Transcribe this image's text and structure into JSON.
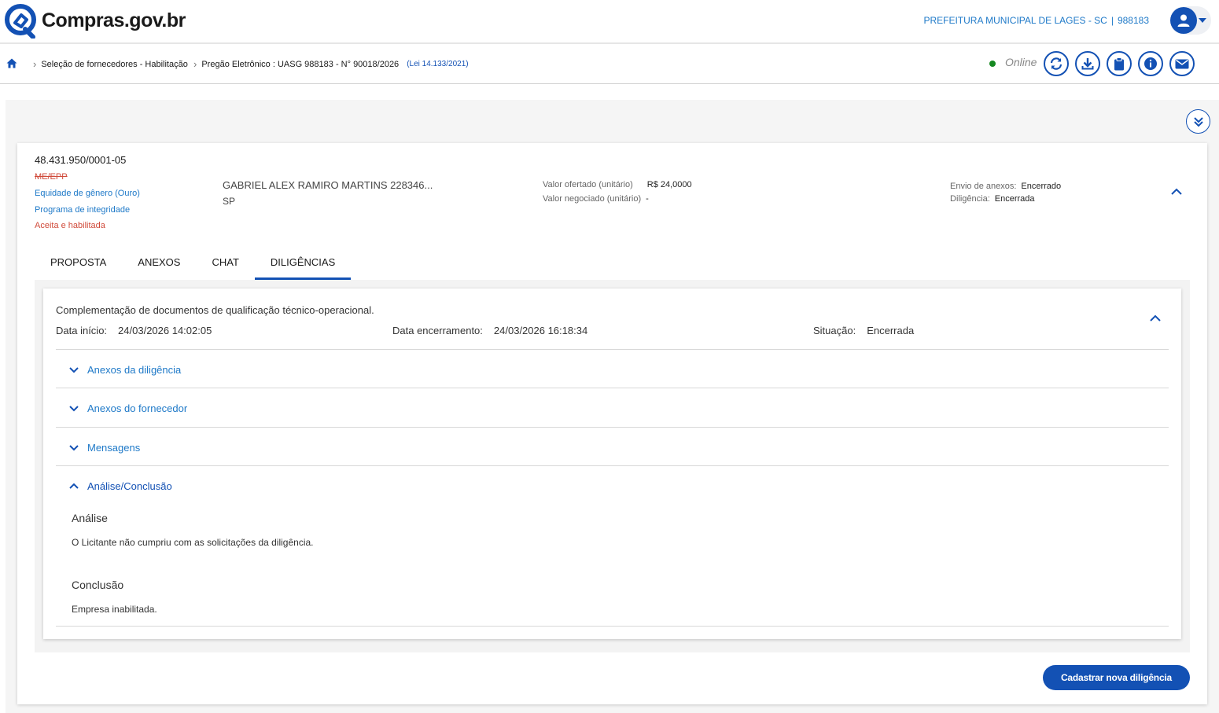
{
  "header": {
    "logo_text": "Compras.gov.br",
    "org_name": "PREFEITURA MUNICIPAL DE LAGES - SC",
    "org_sep": "|",
    "org_code": "988183"
  },
  "breadcrumb": {
    "items": [
      "Seleção de fornecedores - Habilitação",
      "Pregão Eletrônico : UASG 988183 - N° 90018/2026"
    ],
    "lei": "(Lei 14.133/2021)"
  },
  "status": {
    "online_label": "Online"
  },
  "supplier": {
    "cnpj": "48.431.950/0001-05",
    "tags": {
      "me_epp": "ME/EPP",
      "equidade": "Equidade de gênero (Ouro)",
      "integridade": "Programa de integridade",
      "situacao": "Aceita e habilitada"
    },
    "name": "GABRIEL ALEX RAMIRO MARTINS 228346...",
    "uf": "SP",
    "valor_ofertado_label": "Valor ofertado (unitário)",
    "valor_ofertado": "R$ 24,0000",
    "valor_negociado_label": "Valor negociado (unitário)",
    "valor_negociado": "-",
    "envio_anexos_label": "Envio de anexos:",
    "envio_anexos": "Encerrado",
    "diligencia_label": "Diligência:",
    "diligencia": "Encerrada"
  },
  "tabs": [
    {
      "label": "PROPOSTA"
    },
    {
      "label": "ANEXOS"
    },
    {
      "label": "CHAT"
    },
    {
      "label": "DILIGÊNCIAS"
    }
  ],
  "diligencia": {
    "title": "Complementação de documentos de qualificação técnico-operacional.",
    "data_inicio_label": "Data início:",
    "data_inicio": "24/03/2026 14:02:05",
    "data_encerramento_label": "Data encerramento:",
    "data_encerramento": "24/03/2026 16:18:34",
    "situacao_label": "Situação:",
    "situacao": "Encerrada",
    "sections": {
      "anexos_diligencia": "Anexos da diligência",
      "anexos_fornecedor": "Anexos do fornecedor",
      "mensagens": "Mensagens",
      "analise_conclusao": "Análise/Conclusão"
    },
    "analise_title": "Análise",
    "analise_text": "O Licitante não cumpriu com as solicitações da diligência.",
    "conclusao_title": "Conclusão",
    "conclusao_text": "Empresa inabilitada."
  },
  "actions": {
    "nova_diligencia": "Cadastrar nova diligência"
  },
  "colors": {
    "primary": "#1351b4",
    "link": "#1e79c8",
    "danger": "#d04a3a",
    "online": "#168821"
  }
}
